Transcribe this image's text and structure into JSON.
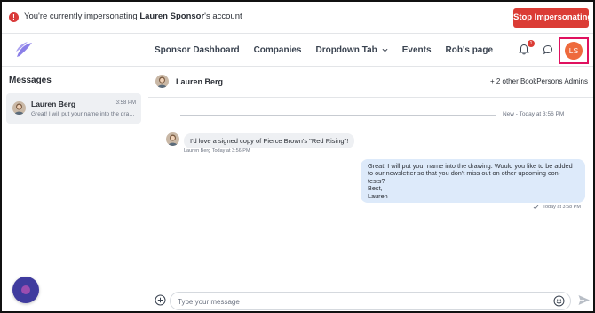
{
  "banner": {
    "text_before": "You're currently impersonating ",
    "user": "Lauren Sponsor",
    "text_after": "'s account",
    "stop_label": "Stop Impersonating",
    "warn_glyph": "!"
  },
  "nav": {
    "items": [
      {
        "label": "Sponsor Dashboard"
      },
      {
        "label": "Companies"
      },
      {
        "label": "Dropdown Tab"
      },
      {
        "label": "Events"
      },
      {
        "label": "Rob's page"
      }
    ],
    "notification_count": "1",
    "avatar_initials": "LS"
  },
  "sidebar": {
    "title": "Messages",
    "conversations": [
      {
        "name": "Lauren Berg",
        "time": "3:58 PM",
        "preview": "Great! I will put your name into the drawing. Would you like to be added"
      }
    ]
  },
  "thread": {
    "name": "Lauren Berg",
    "others": "+ 2 other BookPersons Admins",
    "divider_label": "New - Today at 3:56 PM",
    "incoming": {
      "text": "I'd love a signed copy of Pierce Brown's \"Red Rising\"!",
      "sender": "Lauren Berg",
      "time": "Today at 3:56 PM"
    },
    "outgoing": {
      "lines": [
        "Great! I will put your name into the drawing. Would you like to be added",
        "to our newsletter so that you don't miss out on other upcoming con-",
        "tests?",
        "Best,",
        "Lauren"
      ],
      "time": "Today at 3:58 PM"
    }
  },
  "composer": {
    "placeholder": "Type your message"
  },
  "colors": {
    "accent_red": "#db3c35",
    "avatar_orange": "#ee6a3d",
    "highlight": "#e0115f",
    "outgoing_bubble": "#ddeafa",
    "fab": "#3f3b9e"
  }
}
